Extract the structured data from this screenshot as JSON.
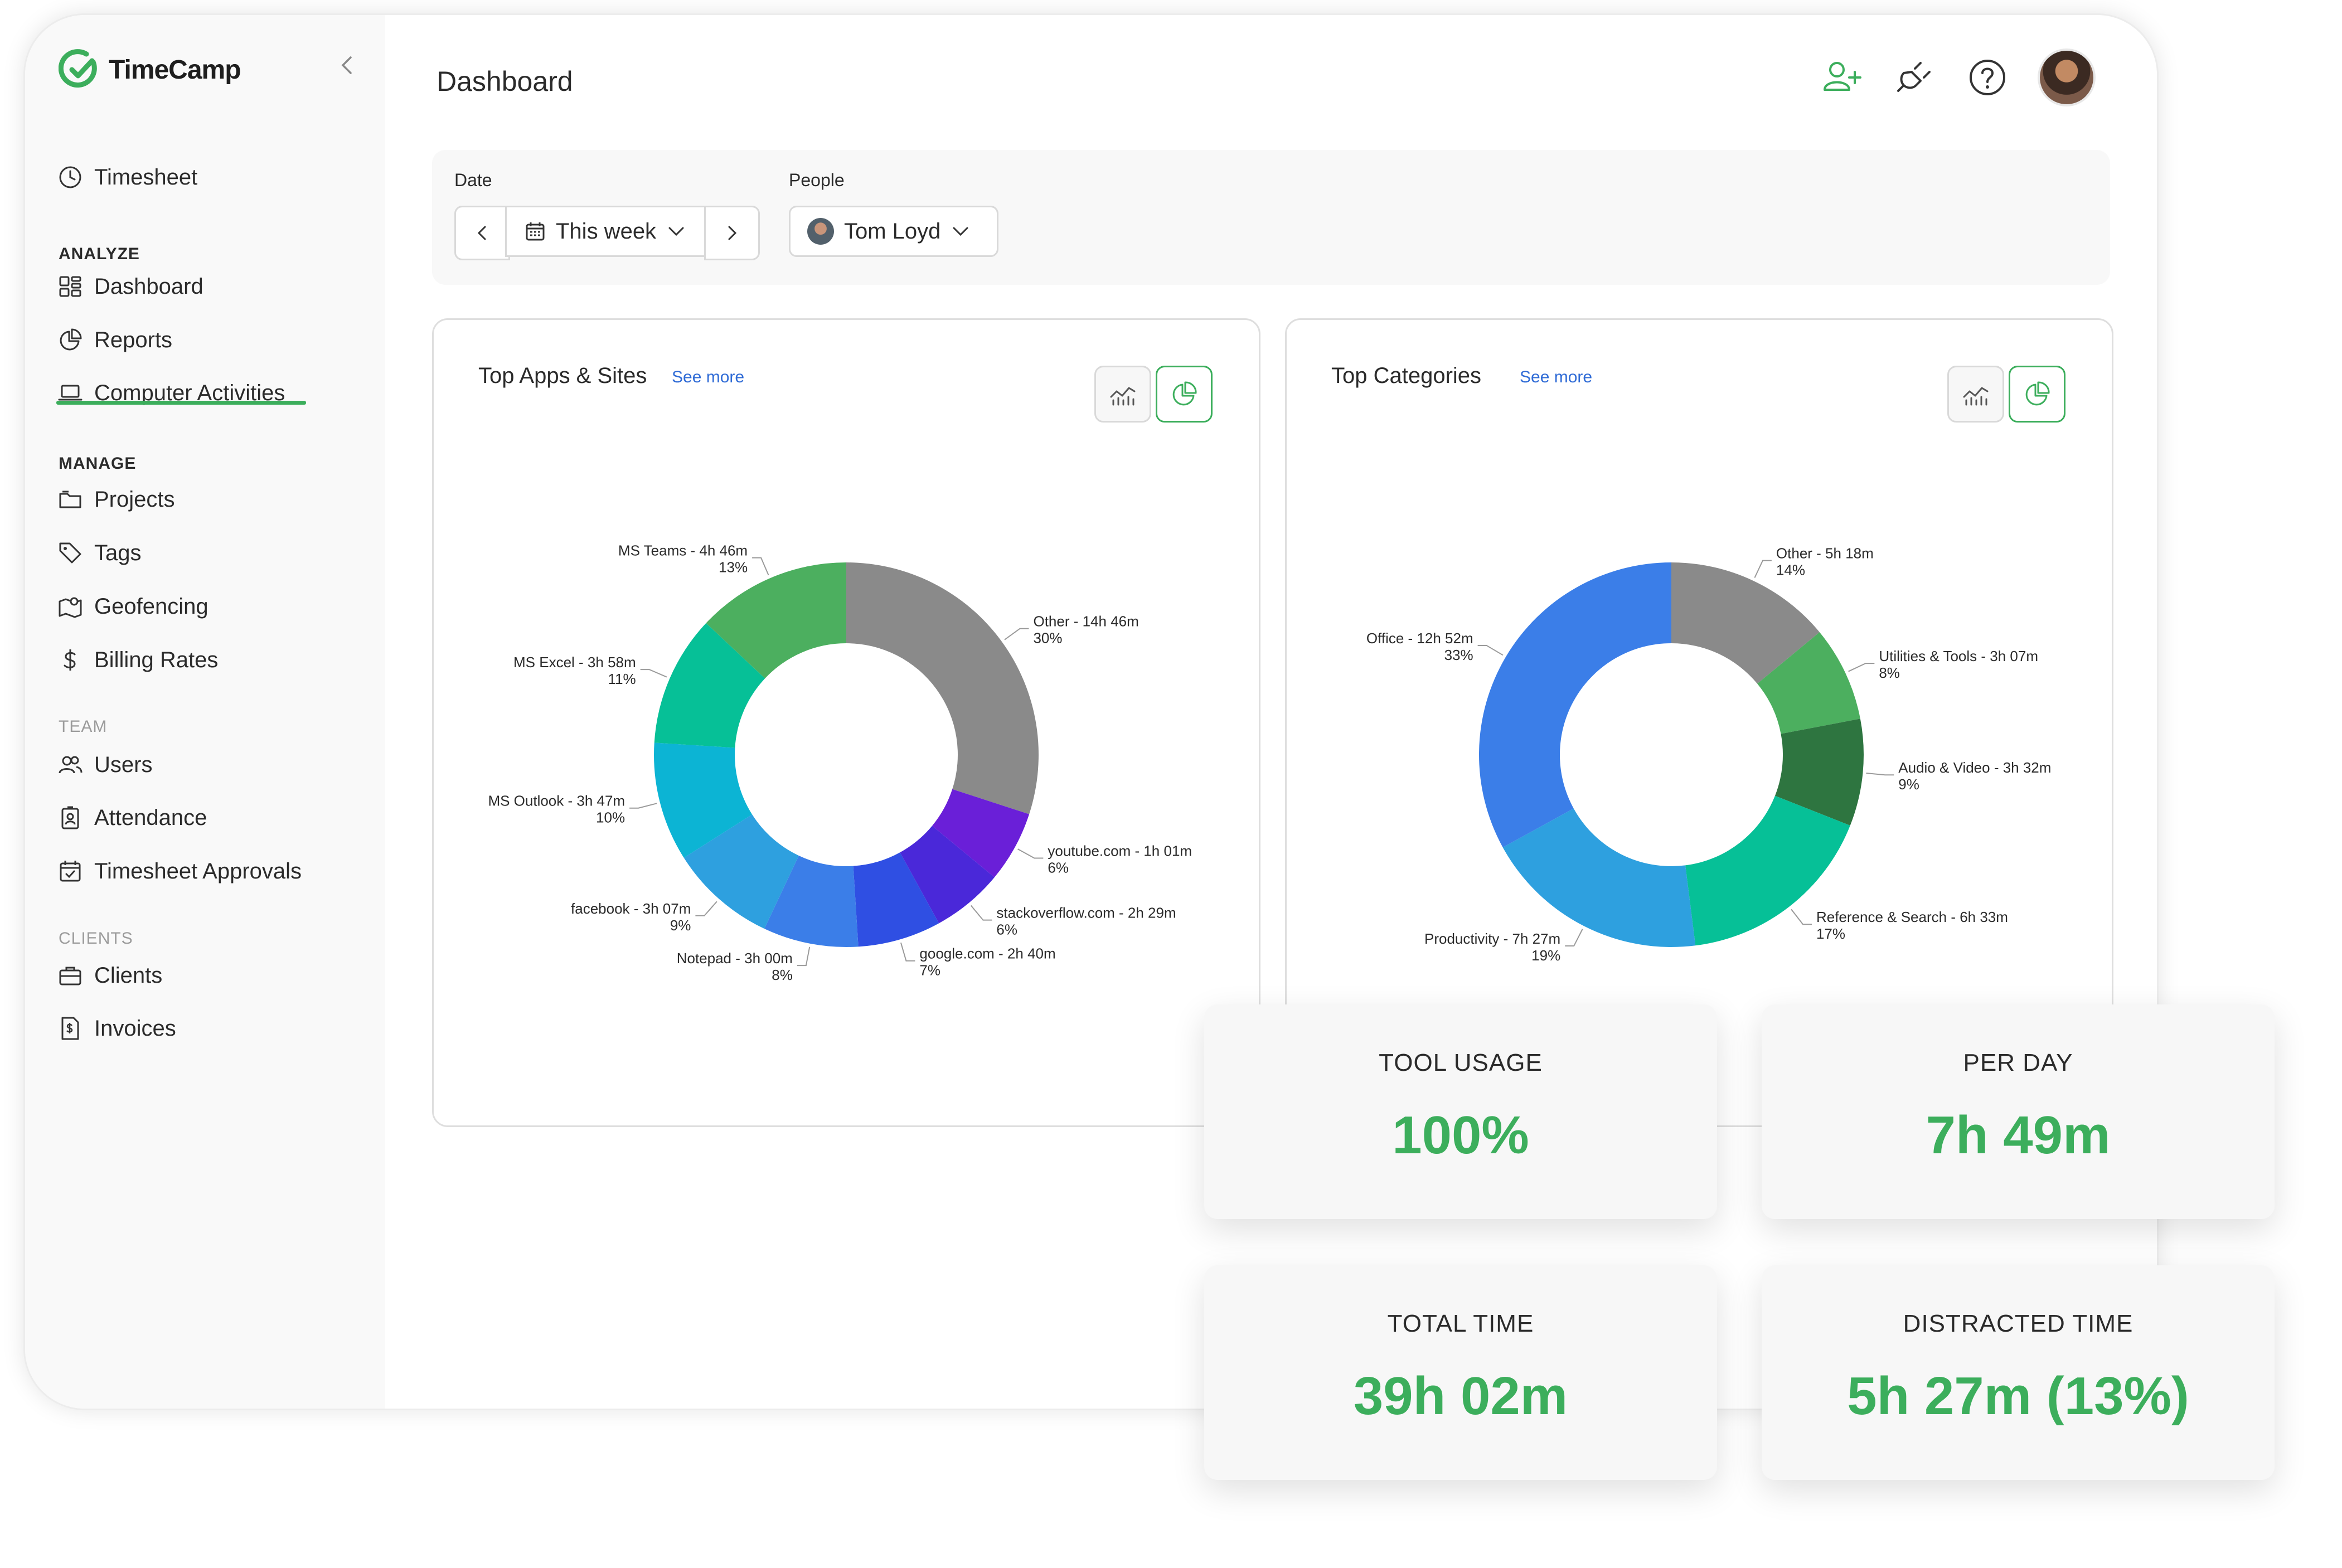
{
  "app": {
    "name": "TimeCamp",
    "brand_color": "#3cae5c"
  },
  "sidebar": {
    "timesheet": "Timesheet",
    "sections": {
      "analyze": "ANALYZE",
      "manage": "MANAGE",
      "team": "TEAM",
      "clients": "CLIENTS"
    },
    "analyze": [
      {
        "label": "Dashboard",
        "icon": "dashboard-icon"
      },
      {
        "label": "Reports",
        "icon": "reports-icon"
      },
      {
        "label": "Computer Activities",
        "icon": "laptop-icon",
        "active": true
      }
    ],
    "manage": [
      {
        "label": "Projects",
        "icon": "folder-icon"
      },
      {
        "label": "Tags",
        "icon": "tag-icon"
      },
      {
        "label": "Geofencing",
        "icon": "map-icon"
      },
      {
        "label": "Billing Rates",
        "icon": "dollar-icon"
      }
    ],
    "team": [
      {
        "label": "Users",
        "icon": "users-icon"
      },
      {
        "label": "Attendance",
        "icon": "badge-icon"
      },
      {
        "label": "Timesheet Approvals",
        "icon": "calendar-check-icon"
      }
    ],
    "clients": [
      {
        "label": "Clients",
        "icon": "briefcase-icon"
      },
      {
        "label": "Invoices",
        "icon": "invoice-icon"
      }
    ]
  },
  "header": {
    "title": "Dashboard"
  },
  "filters": {
    "date_label": "Date",
    "date_value": "This week",
    "people_label": "People",
    "people_value": "Tom Loyd"
  },
  "panels": {
    "apps": {
      "title": "Top Apps & Sites",
      "see_more": "See more"
    },
    "categories": {
      "title": "Top Categories",
      "see_more": "See more"
    }
  },
  "chart_data": [
    {
      "type": "pie",
      "title": "Top Apps & Sites",
      "slices": [
        {
          "name": "Other",
          "time": "14h 46m",
          "pct": 30,
          "color": "#8a8a8a"
        },
        {
          "name": "youtube.com",
          "time": "1h 01m",
          "pct": 6,
          "color": "#6a1fd8"
        },
        {
          "name": "stackoverflow.com",
          "time": "2h 29m",
          "pct": 6,
          "color": "#4a28d9"
        },
        {
          "name": "google.com",
          "time": "2h 40m",
          "pct": 7,
          "color": "#2f4fe3"
        },
        {
          "name": "Notepad",
          "time": "3h 00m",
          "pct": 8,
          "color": "#3b7ee8"
        },
        {
          "name": "facebook",
          "time": "3h 07m",
          "pct": 9,
          "color": "#2ea0df"
        },
        {
          "name": "MS Outlook",
          "time": "3h 47m",
          "pct": 10,
          "color": "#0cb4d4"
        },
        {
          "name": "MS Excel",
          "time": "3h 58m",
          "pct": 11,
          "color": "#06c097"
        },
        {
          "name": "MS Teams",
          "time": "4h 46m",
          "pct": 13,
          "color": "#4caf5f"
        }
      ]
    },
    {
      "type": "pie",
      "title": "Top Categories",
      "slices": [
        {
          "name": "Other",
          "time": "5h 18m",
          "pct": 14,
          "color": "#8a8a8a"
        },
        {
          "name": "Utilities & Tools",
          "time": "3h 07m",
          "pct": 8,
          "color": "#4caf5f"
        },
        {
          "name": "Audio & Video",
          "time": "3h 32m",
          "pct": 9,
          "color": "#2e7540"
        },
        {
          "name": "Reference & Search",
          "time": "6h 33m",
          "pct": 17,
          "color": "#06c097"
        },
        {
          "name": "Productivity",
          "time": "7h 27m",
          "pct": 19,
          "color": "#2ea0df"
        },
        {
          "name": "Office",
          "time": "12h 52m",
          "pct": 33,
          "color": "#3b7ee8"
        }
      ]
    }
  ],
  "stats": [
    {
      "title": "TOOL USAGE",
      "value": "100%"
    },
    {
      "title": "PER DAY",
      "value": "7h 49m"
    },
    {
      "title": "TOTAL TIME",
      "value": "39h 02m"
    },
    {
      "title": "DISTRACTED TIME",
      "value": "5h 27m (13%)"
    }
  ]
}
